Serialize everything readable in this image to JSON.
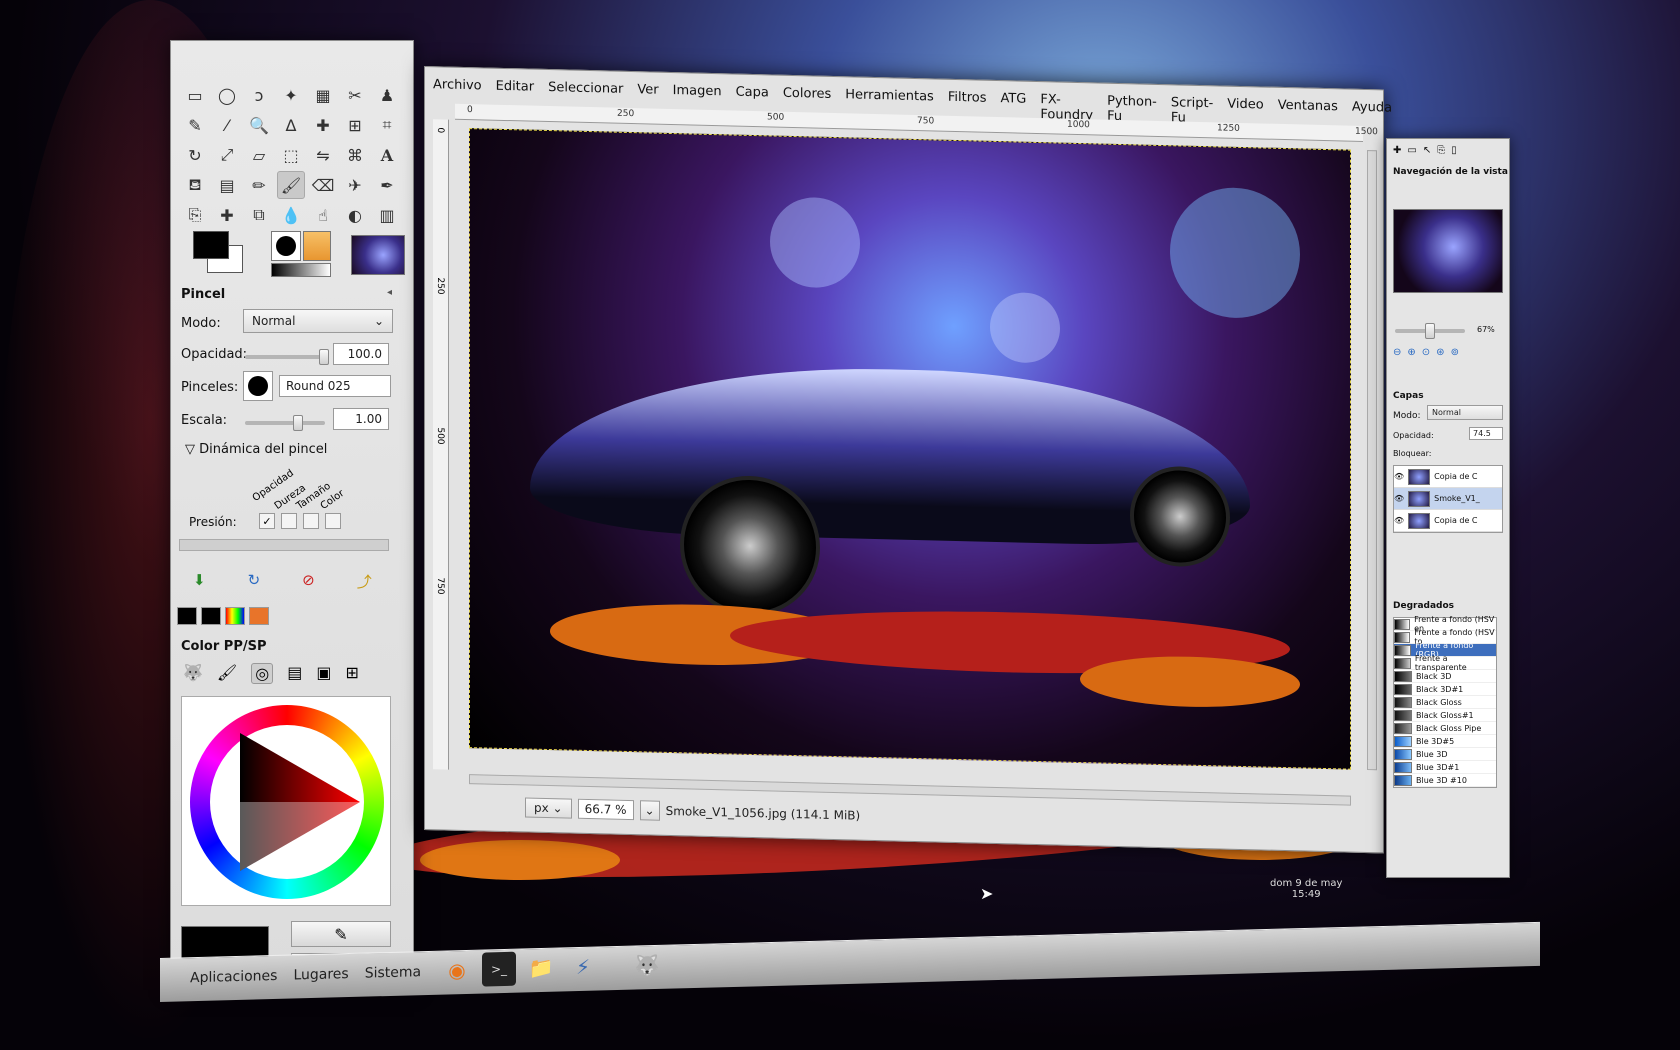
{
  "toolbox": {
    "tool_options_title": "Pincel",
    "mode_label": "Modo:",
    "mode_value": "Normal",
    "opacity_label": "Opacidad:",
    "opacity_value": "100.0",
    "brushes_label": "Pinceles:",
    "brush_value": "Round  025",
    "scale_label": "Escala:",
    "scale_value": "1.00",
    "dynamics_label": "Dinámica del pincel",
    "dyn_columns": [
      "Opacidad",
      "Dureza",
      "Tamaño",
      "Color"
    ],
    "pressure_label": "Presión:",
    "color_dialog_title": "Color PP/SP"
  },
  "image_window": {
    "menu": [
      "Archivo",
      "Editar",
      "Seleccionar",
      "Ver",
      "Imagen",
      "Capa",
      "Colores",
      "Herramientas",
      "Filtros",
      "ATG",
      "FX-Foundry",
      "Python-Fu",
      "Script-Fu",
      "Video",
      "Ventanas",
      "Ayuda"
    ],
    "ruler_ticks": [
      "0",
      "250",
      "500",
      "750",
      "1000",
      "1250",
      "1500"
    ],
    "ruler_v_ticks": [
      "0",
      "250",
      "500",
      "750"
    ],
    "unit": "px",
    "zoom": "66.7 %",
    "status": "Smoke_V1_1056.jpg (114.1 MiB)"
  },
  "dock": {
    "nav_title": "Navegación de la vista",
    "nav_zoom": "67%",
    "layers_title": "Capas",
    "layers_mode_label": "Modo:",
    "layers_mode_value": "Normal",
    "layers_opacity_label": "Opacidad:",
    "layers_opacity_value": "74.5",
    "lock_label": "Bloquear:",
    "layers": [
      "Copia de C",
      "Smoke_V1_",
      "Copia de C"
    ],
    "gradients_title": "Degradados",
    "gradients": [
      {
        "name": "Frente a fondo (HSV en",
        "colors": [
          "#000",
          "#fff"
        ]
      },
      {
        "name": "Frente a fondo (HSV to",
        "colors": [
          "#000",
          "#fff"
        ]
      },
      {
        "name": "Frente a fondo (RGB)",
        "colors": [
          "#000",
          "#fff"
        ]
      },
      {
        "name": "Frente a transparente",
        "colors": [
          "#000",
          "#ccc"
        ]
      },
      {
        "name": "Black 3D",
        "colors": [
          "#000",
          "#777"
        ]
      },
      {
        "name": "Black 3D#1",
        "colors": [
          "#000",
          "#666"
        ]
      },
      {
        "name": "Black Gloss",
        "colors": [
          "#111",
          "#888"
        ]
      },
      {
        "name": "Black Gloss#1",
        "colors": [
          "#111",
          "#777"
        ]
      },
      {
        "name": "Black Gloss Pipe",
        "colors": [
          "#222",
          "#999"
        ]
      },
      {
        "name": "Ble 3D#5",
        "colors": [
          "#0a5cc9",
          "#9dd0ff"
        ]
      },
      {
        "name": "Blue 3D",
        "colors": [
          "#0b49a8",
          "#8ac8ff"
        ]
      },
      {
        "name": "Blue 3D#1",
        "colors": [
          "#0a3d90",
          "#7ab9f6"
        ]
      },
      {
        "name": "Blue 3D #10",
        "colors": [
          "#0a3888",
          "#6ab0f0"
        ]
      }
    ]
  },
  "panel": {
    "menu": [
      "Aplicaciones",
      "Lugares",
      "Sistema"
    ],
    "clock_date": "dom  9 de may",
    "clock_time": "15:49"
  }
}
